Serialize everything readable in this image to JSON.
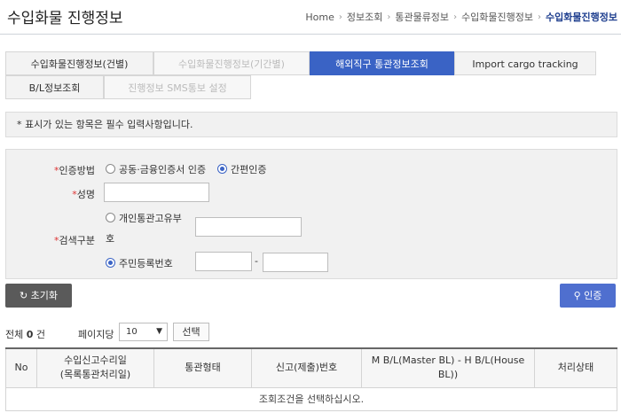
{
  "page": {
    "title": "수입화물 진행정보",
    "breadcrumb": [
      "Home",
      "정보조회",
      "통관물류정보",
      "수입화물진행정보",
      "수입화물진행정보"
    ]
  },
  "tabs": [
    {
      "label": "수입화물진행정보(건별)"
    },
    {
      "label": "수입화물진행정보(기간별)"
    },
    {
      "label": "해외직구 통관정보조회"
    },
    {
      "label": "Import cargo tracking"
    },
    {
      "label": "B/L정보조회"
    },
    {
      "label": "진행정보 SMS통보 설정"
    }
  ],
  "notice": "* 표시가 있는 항목은 필수 입력사항입니다.",
  "form": {
    "auth_method_label": "인증방법",
    "auth_opt_cert": "공동·금융인증서 인증",
    "auth_opt_simple": "간편인증",
    "name_label": "성명",
    "search_type_label": "검색구분",
    "opt_customs_no_line1": "개인통관고유부",
    "opt_customs_no_line2": "호",
    "opt_rrn": "주민등록번호",
    "rrn_separator": "-",
    "required_mark": "*"
  },
  "buttons": {
    "reset": "초기화",
    "auth": "인증",
    "select": "선택"
  },
  "list": {
    "total_prefix": "전체",
    "total_count": "0",
    "total_suffix": "건",
    "per_page_label": "페이지당",
    "per_page_value": "10"
  },
  "table": {
    "headers": {
      "no": "No",
      "declaration_line1": "수입신고수리일",
      "declaration_line2": "(목록통관처리일)",
      "clearance_type": "통관형태",
      "declaration_no": "신고(제출)번호",
      "bl": "M B/L(Master BL) - H B/L(House BL))",
      "status": "처리상태"
    },
    "empty_message": "조회조건을 선택하십시오."
  },
  "colors": {
    "accent": "#3a63c5",
    "reset_btn": "#5a5a5a",
    "required": "#d33333"
  }
}
